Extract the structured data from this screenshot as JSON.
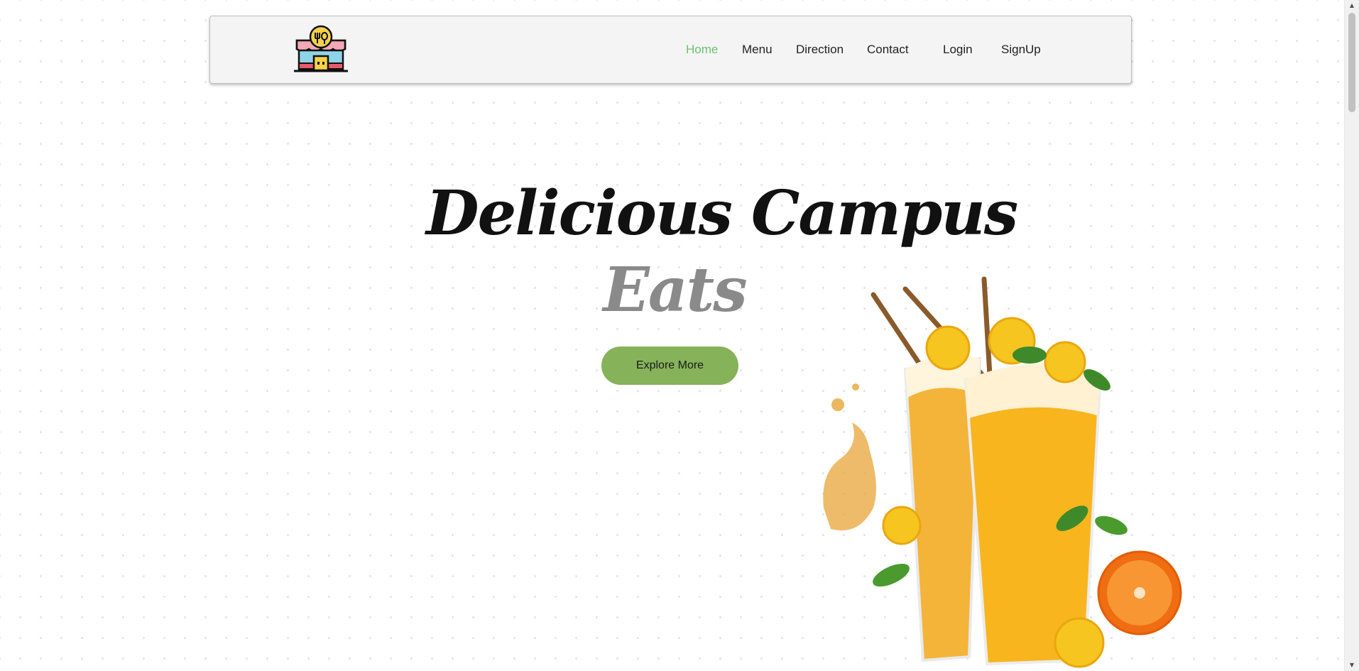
{
  "nav": {
    "logo_icon": "restaurant-storefront-icon",
    "links": [
      {
        "label": "Home",
        "active": true
      },
      {
        "label": "Menu",
        "active": false
      },
      {
        "label": "Direction",
        "active": false
      },
      {
        "label": "Contact",
        "active": false
      },
      {
        "label": "Login",
        "active": false
      },
      {
        "label": "SignUp",
        "active": false
      }
    ],
    "active_color": "#6cc26c"
  },
  "hero": {
    "title_line1": "Delicious Campus",
    "title_line2": "Eats",
    "cta_label": "Explore More",
    "cta_color": "#86b25a",
    "image_icon": "orange-juice-glasses-image"
  }
}
